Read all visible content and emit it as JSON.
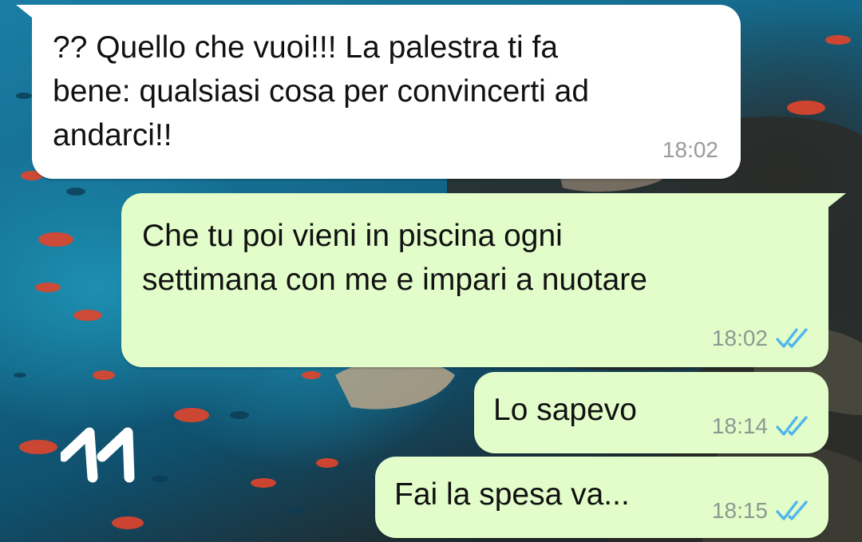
{
  "chat": {
    "wallpaper": "underwater-coral-reef",
    "sticker_text": "11",
    "colors": {
      "incoming_bubble": "#ffffff",
      "outgoing_bubble": "#e2fdca",
      "read_tick": "#4fb6ec",
      "timestamp": "#8b9a90"
    },
    "messages": [
      {
        "direction": "incoming",
        "text": "?? Quello che vuoi!!! La palestra ti fa\nbene: qualsiasi cosa per convincerti ad\nandarci!!",
        "time": "18:02"
      },
      {
        "direction": "outgoing",
        "text": "Che tu poi vieni in piscina ogni\nsettimana con me e impari a nuotare",
        "time": "18:02",
        "status": "read"
      },
      {
        "direction": "outgoing",
        "text": "Lo sapevo",
        "time": "18:14",
        "status": "read"
      },
      {
        "direction": "outgoing",
        "text": "Fai la spesa va...",
        "time": "18:15",
        "status": "read"
      }
    ]
  }
}
